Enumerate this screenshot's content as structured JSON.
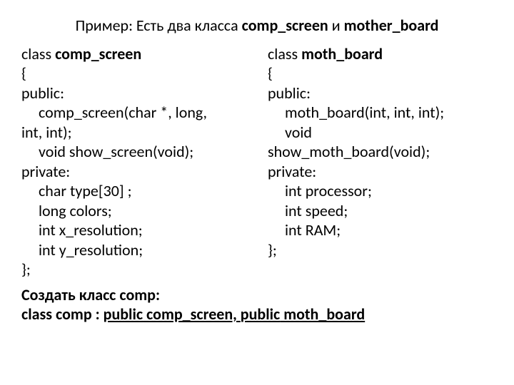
{
  "title": {
    "prefix": "Пример: Есть два класса ",
    "c1": "comp_screen",
    "mid": " и  ",
    "c2": "mother_board"
  },
  "left": {
    "l1a": "class ",
    "l1b": "comp_screen",
    "l2": "{",
    "l3": "public:",
    "l4": "comp_screen(char *, long,",
    "l5": "int, int);",
    "l6": "void show_screen(void);",
    "l7": "private:",
    "l8": "char type[30] ;",
    "l9": "long colors;",
    "l10": "int x_resolution;",
    "l11": "int y_resolution;",
    "l12": "};"
  },
  "right": {
    "l1a": "class ",
    "l1b": "moth_board",
    "l2": "{",
    "l3": "public:",
    "l4": "moth_board(int, int, int);",
    "l5": "void",
    "l6": "show_moth_board(void);",
    "l7": "private:",
    "l8": "int processor;",
    "l9": "int speed;",
    "l10": "int RAM;",
    "l11": "};"
  },
  "footer": {
    "f1": "Создать класс comp:",
    "f2a": "class comp : ",
    "f2b": "public",
    "f2c": " comp_screen, ",
    "f2d": "public",
    "f2e": " moth_board"
  }
}
